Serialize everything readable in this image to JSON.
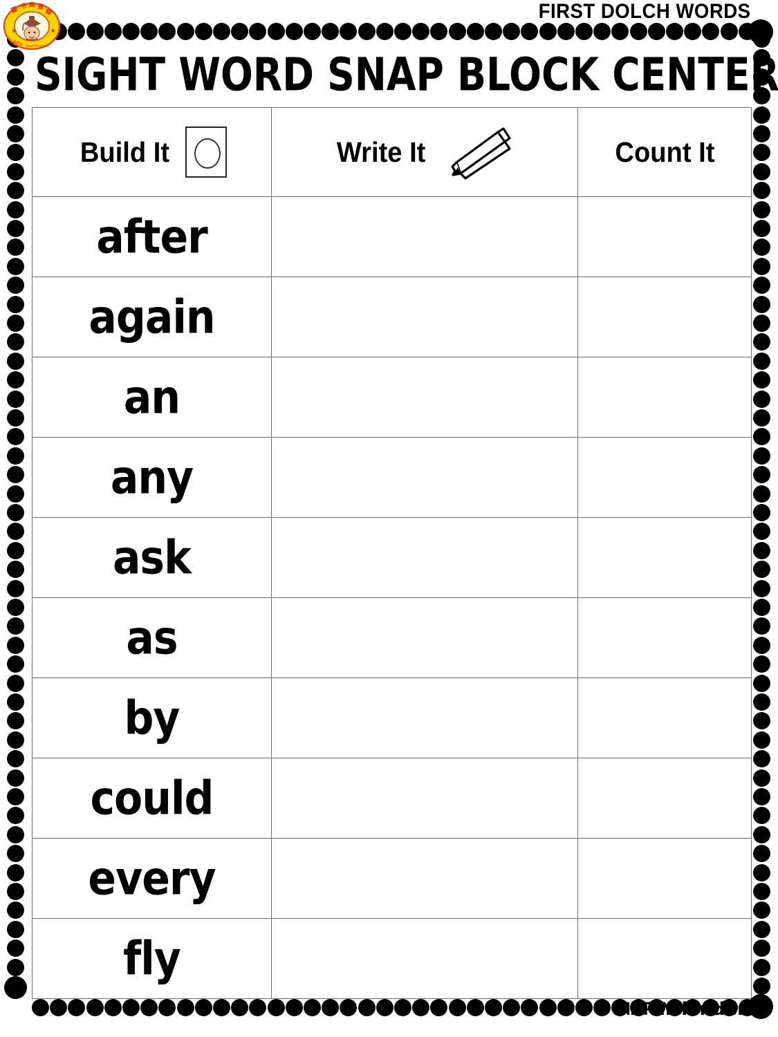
{
  "header": {
    "kicker": "FIRST DOLCH WORDS",
    "title": "SIGHT WORD SNAP BLOCK CENTER",
    "logo_alt": "teacher-badge-logo",
    "logo_colors": {
      "ring": "#f5d500",
      "ring_border": "#e04a1a",
      "text": "#d6321b",
      "cap": "#8a4a3c",
      "face": "#f2c9a0",
      "inner": "#fdf6d8"
    }
  },
  "table": {
    "columns": [
      {
        "label": "Build It",
        "icon": "snap-block-icon"
      },
      {
        "label": "Write It",
        "icon": "pencil-icon"
      },
      {
        "label": "Count It",
        "icon": null
      }
    ],
    "rows": [
      {
        "word": "after",
        "write": "",
        "count": ""
      },
      {
        "word": "again",
        "write": "",
        "count": ""
      },
      {
        "word": "an",
        "write": "",
        "count": ""
      },
      {
        "word": "any",
        "write": "",
        "count": ""
      },
      {
        "word": "ask",
        "write": "",
        "count": ""
      },
      {
        "word": "as",
        "write": "",
        "count": ""
      },
      {
        "word": "by",
        "write": "",
        "count": ""
      },
      {
        "word": "could",
        "write": "",
        "count": ""
      },
      {
        "word": "every",
        "write": "",
        "count": ""
      },
      {
        "word": "fly",
        "write": "",
        "count": ""
      }
    ]
  },
  "footer": {
    "copyright_symbol": "©",
    "brand_primary": "SIMPLY",
    "brand_secondary": "kinder"
  },
  "style": {
    "ink": "#000000",
    "grid_line": "#6d6d6d",
    "paper": "#ffffff"
  }
}
